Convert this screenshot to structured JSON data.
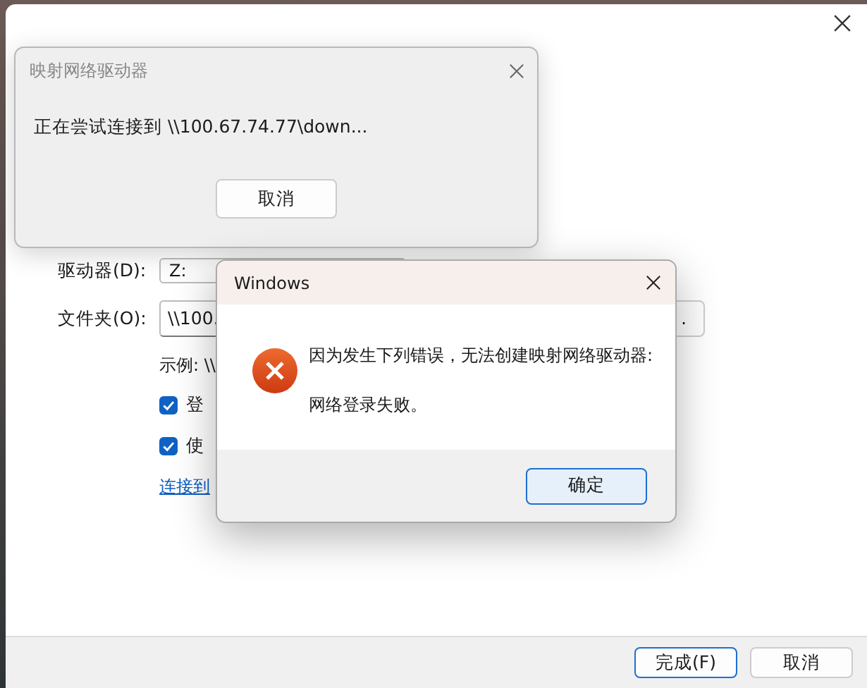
{
  "background_window": {
    "fields": [
      {
        "label": "驱动器(D):",
        "value": "Z:",
        "kind": "dropdown"
      },
      {
        "label": "文件夹(O):",
        "value": "\\\\100.",
        "kind": "text"
      }
    ],
    "browse_button": ".",
    "example": "示例: \\\\",
    "options": [
      {
        "label": "登",
        "checked": true
      },
      {
        "label": "使",
        "checked": true
      }
    ],
    "link": "连接到",
    "buttons": [
      {
        "label": "完成(F)",
        "default": true
      },
      {
        "label": "取消",
        "default": false
      }
    ]
  },
  "progress_dialog": {
    "title": "映射网络驱动器",
    "message": "正在尝试连接到 \\\\100.67.74.77\\down...",
    "button": "取消"
  },
  "error_dialog": {
    "title": "Windows",
    "message": "因为发生下列错误，无法创建映射网络驱动器:",
    "detail": "网络登录失败。",
    "button": "确定"
  }
}
